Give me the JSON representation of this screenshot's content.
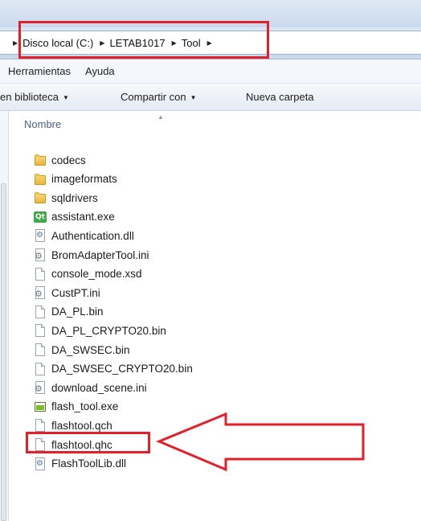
{
  "breadcrumb": {
    "items": [
      "Disco local (C:)",
      "LETAB1017",
      "Tool"
    ]
  },
  "menu": {
    "items": [
      "Herramientas",
      "Ayuda"
    ]
  },
  "toolbar": {
    "library_label": "en biblioteca",
    "share_label": "Compartir con",
    "new_folder_label": "Nueva carpeta"
  },
  "list": {
    "column_name": "Nombre",
    "files": [
      {
        "name": "codecs",
        "icon": "folder-icon"
      },
      {
        "name": "imageformats",
        "icon": "folder-icon"
      },
      {
        "name": "sqldrivers",
        "icon": "folder-icon"
      },
      {
        "name": "assistant.exe",
        "icon": "qt-icon"
      },
      {
        "name": "Authentication.dll",
        "icon": "dll-icon"
      },
      {
        "name": "BromAdapterTool.ini",
        "icon": "settings-file-icon"
      },
      {
        "name": "console_mode.xsd",
        "icon": "file-icon"
      },
      {
        "name": "CustPT.ini",
        "icon": "settings-file-icon"
      },
      {
        "name": "DA_PL.bin",
        "icon": "file-icon"
      },
      {
        "name": "DA_PL_CRYPTO20.bin",
        "icon": "file-icon"
      },
      {
        "name": "DA_SWSEC.bin",
        "icon": "file-icon"
      },
      {
        "name": "DA_SWSEC_CRYPTO20.bin",
        "icon": "file-icon"
      },
      {
        "name": "download_scene.ini",
        "icon": "settings-file-icon"
      },
      {
        "name": "flash_tool.exe",
        "icon": "exe-icon"
      },
      {
        "name": "flashtool.qch",
        "icon": "file-icon"
      },
      {
        "name": "flashtool.qhc",
        "icon": "file-icon"
      },
      {
        "name": "FlashToolLib.dll",
        "icon": "dll-icon"
      }
    ]
  },
  "colors": {
    "highlight": "#e0202a",
    "header_text": "#4c607a"
  }
}
